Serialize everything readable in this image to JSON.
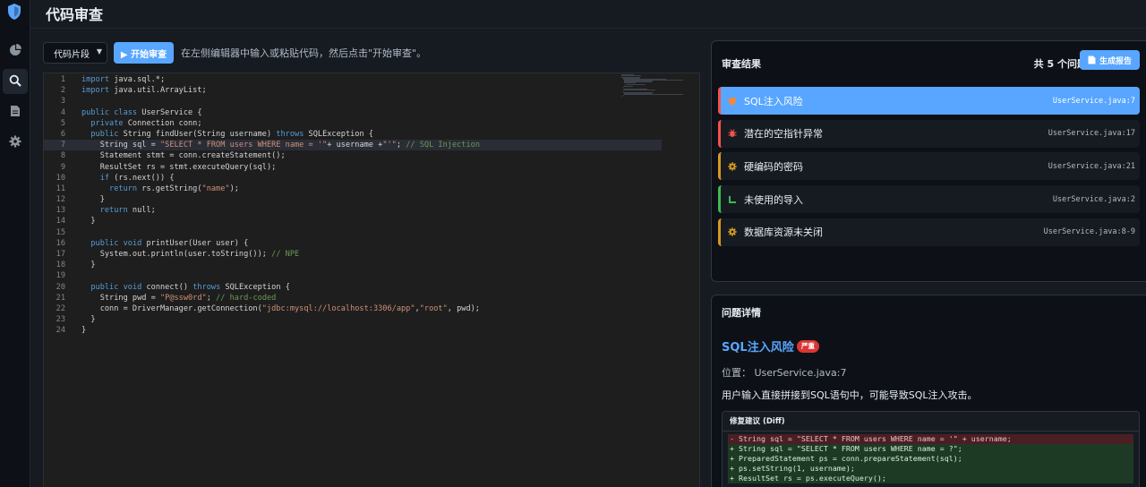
{
  "header": {
    "title": "代码审查"
  },
  "sidebar": {
    "icons": [
      "shield-logo-icon",
      "pie-chart-icon",
      "search-icon",
      "document-icon",
      "gear-icon"
    ]
  },
  "toolbar": {
    "mode_select": "代码片段",
    "start_button": "▶ 开始审查",
    "hint": "在左侧编辑器中输入或粘贴代码，然后点击\"开始审查\"。"
  },
  "editor": {
    "highlight_line": 7,
    "lines": [
      "import java.sql.*;",
      "import java.util.ArrayList;",
      "",
      "public class UserService {",
      "  private Connection conn;",
      "  public String findUser(String username) throws SQLException {",
      "    String sql = \"SELECT * FROM users WHERE name = '\"+ username +\"'\"; // SQL Injection",
      "    Statement stmt = conn.createStatement();",
      "    ResultSet rs = stmt.executeQuery(sql);",
      "    if (rs.next()) {",
      "      return rs.getString(\"name\");",
      "    }",
      "    return null;",
      "  }",
      "",
      "  public void printUser(User user) {",
      "    System.out.println(user.toString()); // NPE",
      "  }",
      "",
      "  public void connect() throws SQLException {",
      "    String pwd = \"P@ssw0rd\"; // hard-coded",
      "    conn = DriverManager.getConnection(\"jdbc:mysql://localhost:3306/app\",\"root\", pwd);",
      "  }",
      "}"
    ]
  },
  "results": {
    "title": "审查结果",
    "count_label": "共 5 个问题",
    "report_button": "生成报告",
    "issues": [
      {
        "label": "SQL注入风险",
        "file": "UserService.java:7",
        "color": "#f85149",
        "icon": "shield-icon",
        "active": true
      },
      {
        "label": "潜在的空指针异常",
        "file": "UserService.java:17",
        "color": "#f85149",
        "icon": "bug-icon",
        "active": false
      },
      {
        "label": "硬编码的密码",
        "file": "UserService.java:21",
        "color": "#d29922",
        "icon": "gear-warning-icon",
        "active": false
      },
      {
        "label": "未使用的导入",
        "file": "UserService.java:2",
        "color": "#3fb950",
        "icon": "chart-icon",
        "active": false
      },
      {
        "label": "数据库资源未关闭",
        "file": "UserService.java:8-9",
        "color": "#d29922",
        "icon": "gear-warning-icon",
        "active": false
      }
    ]
  },
  "detail": {
    "title": "问题详情",
    "issue_title": "SQL注入风险",
    "severity": "严重",
    "location": "位置： UserService.java:7",
    "description": "用户输入直接拼接到SQL语句中，可能导致SQL注入攻击。",
    "diff_title": "修复建议 (Diff)",
    "diff": [
      {
        "type": "del",
        "text": "- String sql = \"SELECT * FROM users WHERE name = '\" + username;"
      },
      {
        "type": "add",
        "text": "+ String sql = \"SELECT * FROM users WHERE name = ?\";"
      },
      {
        "type": "add",
        "text": "+ PreparedStatement ps = conn.prepareStatement(sql);"
      },
      {
        "type": "add",
        "text": "+ ps.setString(1, username);"
      },
      {
        "type": "add",
        "text": "+ ResultSet rs = ps.executeQuery();"
      }
    ]
  }
}
